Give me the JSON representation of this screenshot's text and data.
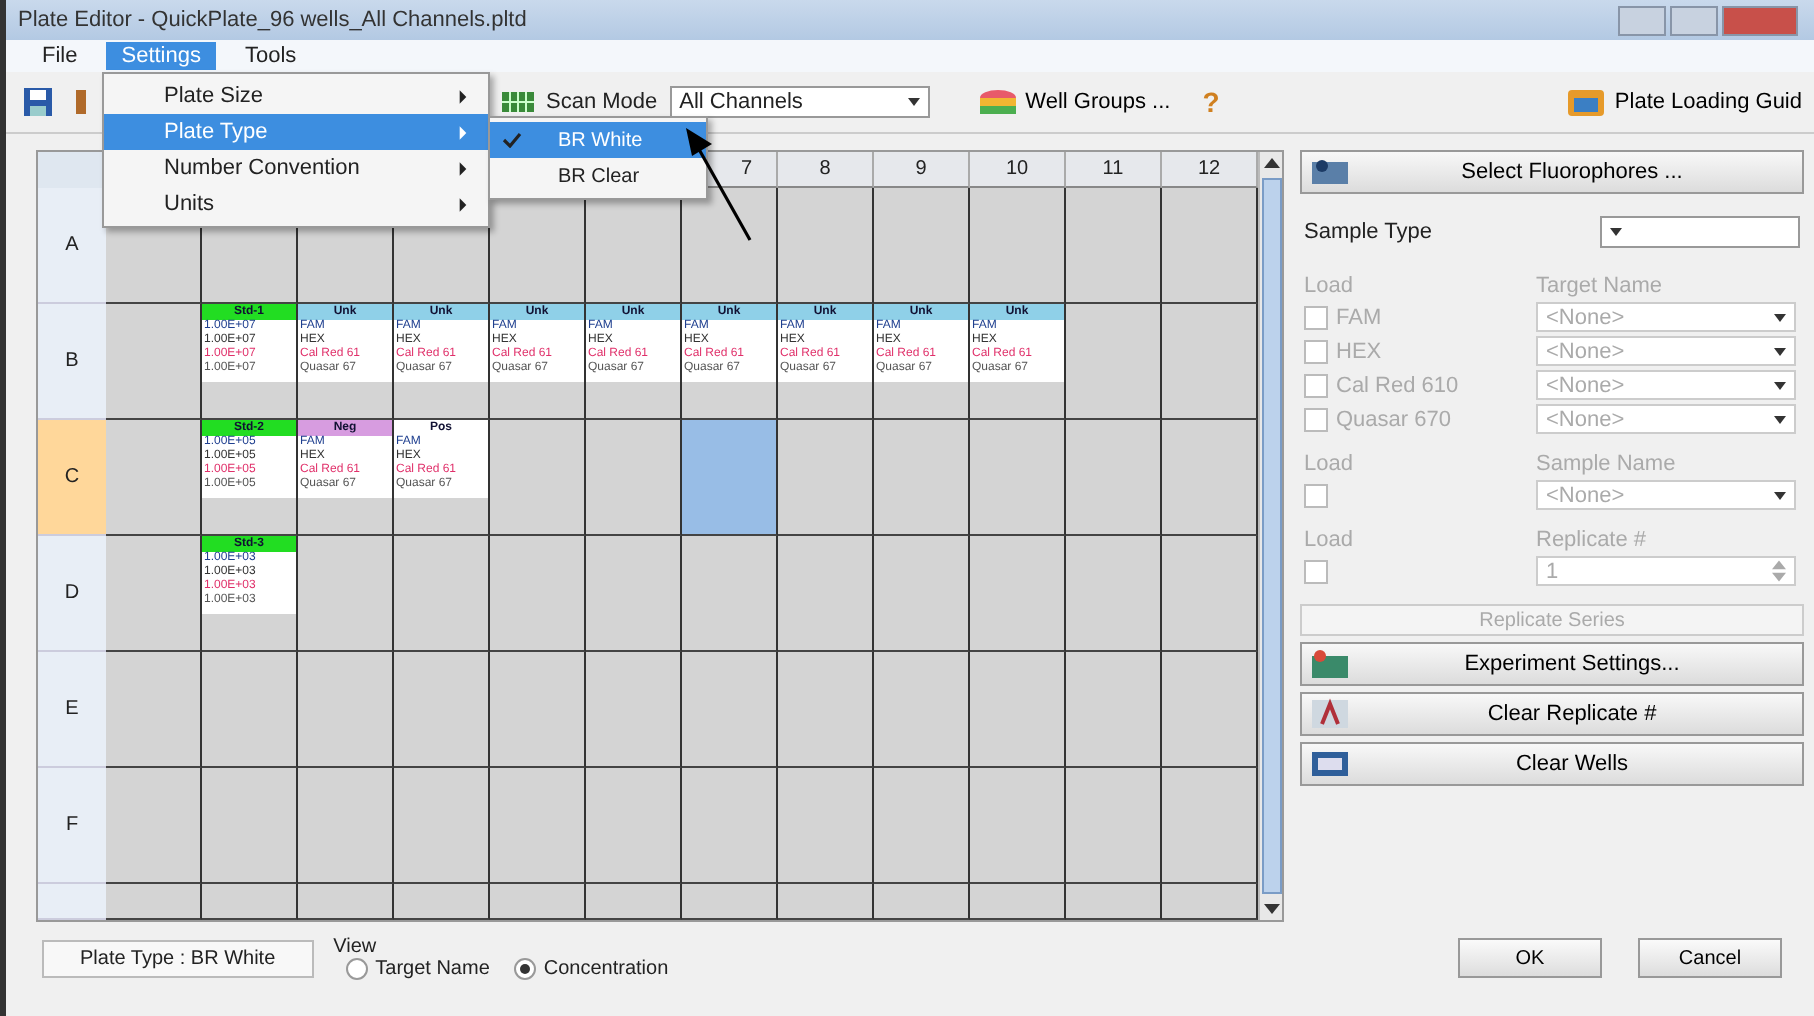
{
  "window": {
    "title": "Plate Editor - QuickPlate_96 wells_All Channels.pltd"
  },
  "menu_bar": [
    {
      "label": "File",
      "selected": false
    },
    {
      "label": "Settings",
      "selected": true
    },
    {
      "label": "Tools",
      "selected": false
    }
  ],
  "settings_menu": [
    {
      "label": "Plate Size",
      "selected": false,
      "has_submenu": true
    },
    {
      "label": "Plate Type",
      "selected": true,
      "has_submenu": true
    },
    {
      "label": "Number Convention",
      "selected": false,
      "has_submenu": true
    },
    {
      "label": "Units",
      "selected": false,
      "has_submenu": true
    }
  ],
  "plate_type_submenu": [
    {
      "label": "BR White",
      "selected": true,
      "checked": true
    },
    {
      "label": "BR Clear",
      "selected": false,
      "checked": false
    }
  ],
  "toolbar": {
    "scan_mode_label": "Scan Mode",
    "scan_mode_value": "All Channels",
    "well_groups": "Well Groups ...",
    "help": "?",
    "plate_loading_guide": "Plate Loading Guid"
  },
  "plate": {
    "columns": [
      {},
      {},
      {},
      {},
      {},
      {},
      {
        "label": "7"
      },
      {
        "label": "8"
      },
      {
        "label": "9"
      },
      {
        "label": "10"
      },
      {
        "label": "11"
      },
      {
        "label": "12"
      }
    ],
    "rows": [
      {
        "label": "A",
        "selected": false,
        "wells": [
          {
            "selected": false
          },
          {
            "selected": false
          },
          {
            "selected": false
          },
          {
            "selected": false
          },
          {
            "selected": false
          },
          {
            "selected": false
          },
          {
            "selected": false
          },
          {
            "selected": false
          },
          {
            "selected": false
          },
          {
            "selected": false
          },
          {
            "selected": false
          },
          {
            "selected": false
          }
        ]
      },
      {
        "label": "B",
        "selected": false,
        "wells": [
          {
            "selected": false
          },
          {
            "selected": false,
            "kind": "std",
            "type": "Std-1",
            "lines": [
              "1.00E+07",
              "1.00E+07",
              "1.00E+07",
              "1.00E+07"
            ]
          },
          {
            "selected": false,
            "kind": "unk",
            "type": "Unk",
            "lines": [
              "FAM",
              "HEX",
              "Cal Red 61",
              "Quasar 67"
            ]
          },
          {
            "selected": false,
            "kind": "unk",
            "type": "Unk",
            "lines": [
              "FAM",
              "HEX",
              "Cal Red 61",
              "Quasar 67"
            ]
          },
          {
            "selected": false,
            "kind": "unk",
            "type": "Unk",
            "lines": [
              "FAM",
              "HEX",
              "Cal Red 61",
              "Quasar 67"
            ]
          },
          {
            "selected": false,
            "kind": "unk",
            "type": "Unk",
            "lines": [
              "FAM",
              "HEX",
              "Cal Red 61",
              "Quasar 67"
            ]
          },
          {
            "selected": false,
            "kind": "unk",
            "type": "Unk",
            "lines": [
              "FAM",
              "HEX",
              "Cal Red 61",
              "Quasar 67"
            ]
          },
          {
            "selected": false,
            "kind": "unk",
            "type": "Unk",
            "lines": [
              "FAM",
              "HEX",
              "Cal Red 61",
              "Quasar 67"
            ]
          },
          {
            "selected": false,
            "kind": "unk",
            "type": "Unk",
            "lines": [
              "FAM",
              "HEX",
              "Cal Red 61",
              "Quasar 67"
            ]
          },
          {
            "selected": false,
            "kind": "unk",
            "type": "Unk",
            "lines": [
              "FAM",
              "HEX",
              "Cal Red 61",
              "Quasar 67"
            ]
          },
          {
            "selected": false
          },
          {
            "selected": false
          }
        ]
      },
      {
        "label": "C",
        "selected": true,
        "wells": [
          {
            "selected": false
          },
          {
            "selected": false,
            "kind": "std",
            "type": "Std-2",
            "lines": [
              "1.00E+05",
              "1.00E+05",
              "1.00E+05",
              "1.00E+05"
            ]
          },
          {
            "selected": false,
            "kind": "neg",
            "type": "Neg",
            "lines": [
              "FAM",
              "HEX",
              "Cal Red 61",
              "Quasar 67"
            ]
          },
          {
            "selected": false,
            "kind": "pos",
            "type": "Pos",
            "lines": [
              "FAM",
              "HEX",
              "Cal Red 61",
              "Quasar 67"
            ]
          },
          {
            "selected": false
          },
          {
            "selected": false
          },
          {
            "selected": true
          },
          {
            "selected": false
          },
          {
            "selected": false
          },
          {
            "selected": false
          },
          {
            "selected": false
          },
          {
            "selected": false
          }
        ]
      },
      {
        "label": "D",
        "selected": false,
        "wells": [
          {
            "selected": false
          },
          {
            "selected": false,
            "kind": "std",
            "type": "Std-3",
            "lines": [
              "1.00E+03",
              "1.00E+03",
              "1.00E+03",
              "1.00E+03"
            ]
          },
          {
            "selected": false
          },
          {
            "selected": false
          },
          {
            "selected": false
          },
          {
            "selected": false
          },
          {
            "selected": false
          },
          {
            "selected": false
          },
          {
            "selected": false
          },
          {
            "selected": false
          },
          {
            "selected": false
          },
          {
            "selected": false
          }
        ]
      },
      {
        "label": "E",
        "selected": false,
        "wells": [
          {
            "selected": false
          },
          {
            "selected": false
          },
          {
            "selected": false
          },
          {
            "selected": false
          },
          {
            "selected": false
          },
          {
            "selected": false
          },
          {
            "selected": false
          },
          {
            "selected": false
          },
          {
            "selected": false
          },
          {
            "selected": false
          },
          {
            "selected": false
          },
          {
            "selected": false
          }
        ]
      },
      {
        "label": "F",
        "selected": false,
        "wells": [
          {
            "selected": false
          },
          {
            "selected": false
          },
          {
            "selected": false
          },
          {
            "selected": false
          },
          {
            "selected": false
          },
          {
            "selected": false
          },
          {
            "selected": false
          },
          {
            "selected": false
          },
          {
            "selected": false
          },
          {
            "selected": false
          },
          {
            "selected": false
          },
          {
            "selected": false
          }
        ]
      },
      {
        "selected": false,
        "wells": [
          {
            "selected": false
          },
          {
            "selected": false
          },
          {
            "selected": false
          },
          {
            "selected": false
          },
          {
            "selected": false
          },
          {
            "selected": false
          },
          {
            "selected": false
          },
          {
            "selected": false
          },
          {
            "selected": false
          },
          {
            "selected": false
          },
          {
            "selected": false
          },
          {
            "selected": false
          }
        ]
      }
    ]
  },
  "panel": {
    "select_fluorophores": "Select Fluorophores ...",
    "sample_type_label": "Sample Type",
    "dyes": {
      "disabled": true,
      "load_label": "Load",
      "target_label": "Target Name",
      "rows": [
        {
          "name": "FAM",
          "checked": false,
          "target": "<None>"
        },
        {
          "name": "HEX",
          "checked": false,
          "target": "<None>"
        },
        {
          "name": "Cal Red 610",
          "checked": false,
          "target": "<None>"
        },
        {
          "name": "Quasar 670",
          "checked": false,
          "target": "<None>"
        }
      ]
    },
    "sample": {
      "disabled": true,
      "load_label": "Load",
      "label": "Sample Name",
      "checked": false,
      "value": "<None>"
    },
    "replicate": {
      "disabled": true,
      "load_label": "Load",
      "label": "Replicate #",
      "checked": false,
      "value": "1"
    },
    "replicate_series": {
      "label": "Replicate Series",
      "disabled": true
    },
    "actions": [
      {
        "kind": "settings",
        "label": "Experiment Settings..."
      },
      {
        "kind": "replicate",
        "label": "Clear Replicate #"
      },
      {
        "kind": "wells",
        "label": "Clear Wells"
      }
    ]
  },
  "status": {
    "plate_type": "Plate Type : BR White",
    "view_label": "View",
    "view_options": [
      {
        "label": "Target Name",
        "selected": false
      },
      {
        "label": "Concentration",
        "selected": true
      }
    ]
  },
  "dialog_buttons": [
    "OK",
    "Cancel"
  ]
}
